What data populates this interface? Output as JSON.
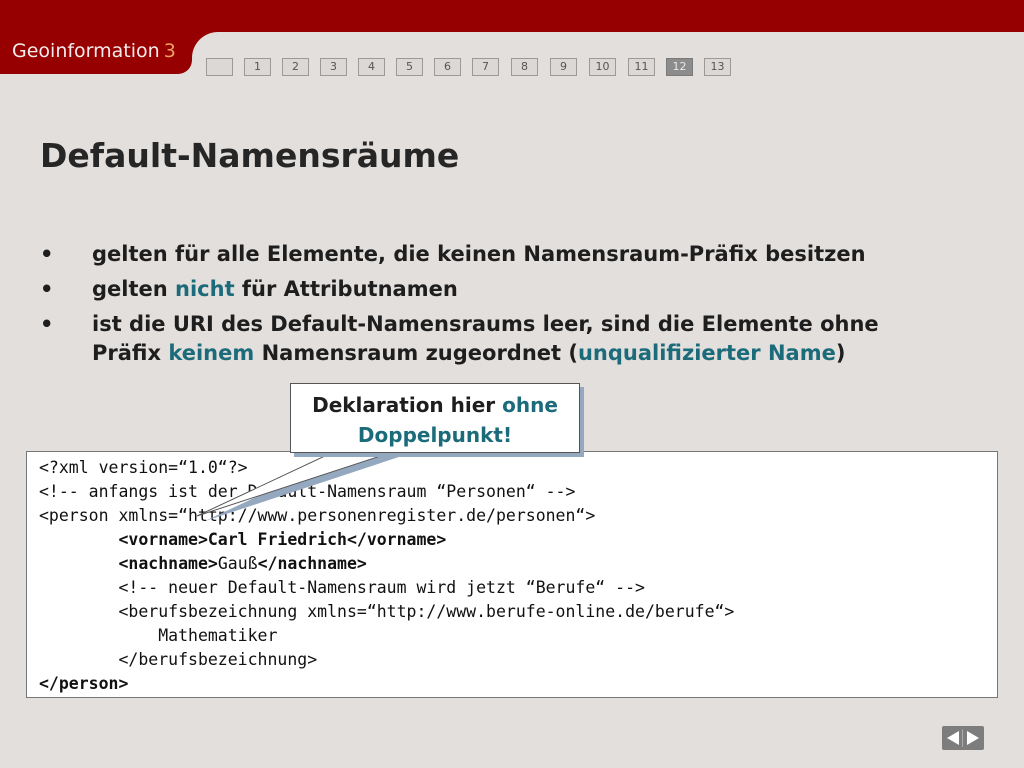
{
  "header": {
    "app_name": "Geoinformation",
    "app_number": "3"
  },
  "pager": {
    "pages": [
      "",
      "1",
      "2",
      "3",
      "4",
      "5",
      "6",
      "7",
      "8",
      "9",
      "10",
      "11",
      "12",
      "13"
    ],
    "current": "12"
  },
  "slide": {
    "title": "Default-Namensräume",
    "bullet_symbol": "•",
    "bullets": {
      "b1": "gelten für alle Elemente, die keinen Namensraum-Präfix besitzen",
      "b2_pre": "gelten ",
      "b2_hl": "nicht",
      "b2_post": " für Attributnamen",
      "b3_pre": "ist die URI des Default-Namensraums leer, sind die Elemente ohne Präfix ",
      "b3_hl1": "keinem",
      "b3_mid": " Namensraum zugeordnet (",
      "b3_hl2": "unqualifizierter Name",
      "b3_post": ")"
    }
  },
  "callout": {
    "line1_pre": "Deklaration hier ",
    "line1_hl": "ohne",
    "line2": "Doppelpunkt!"
  },
  "code": {
    "l1": "<?xml version=“1.0“?>",
    "l2": "<!-- anfangs ist der Default-Namensraum “Personen“ -->",
    "l3": "<person xmlns=“http://www.personenregister.de/personen“>",
    "l4": "        <vorname>Carl Friedrich</vorname>",
    "l5a": "        ",
    "l5b": "<nachname>",
    "l5c": "Gauß",
    "l5d": "</nachname>",
    "l6": "        <!-- neuer Default-Namensraum wird jetzt “Berufe“ -->",
    "l7": "        <berufsbezeichnung xmlns=“http://www.berufe-online.de/berufe“>",
    "l8": "            Mathematiker",
    "l9": "        </berufsbezeichnung>",
    "l10": "</person>"
  },
  "colors": {
    "header_red": "#960000",
    "highlight": "#1b6b7a",
    "background": "#e3dfdd"
  }
}
